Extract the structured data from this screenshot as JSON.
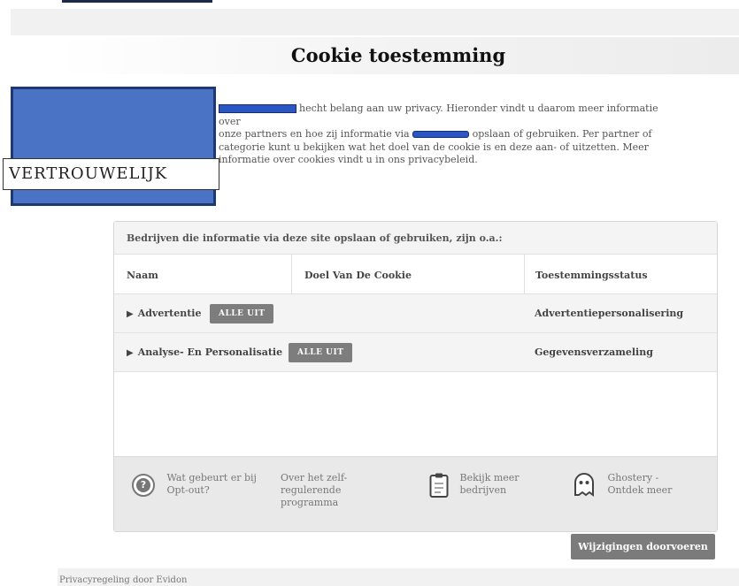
{
  "header": {
    "title": "Cookie toestemming"
  },
  "intro": {
    "part1": "hecht belang aan uw privacy. Hieronder vindt u daarom meer informatie over",
    "part2": "onze partners en hoe zij informatie via",
    "part3": "opslaan of gebruiken. Per partner of",
    "part4": "categorie kunt u bekijken wat het doel van de cookie is en deze aan- of uitzetten. Meer",
    "part5": "informatie over cookies vindt u in ons privacybeleid."
  },
  "overlay": {
    "label": "VERTROUWELIJK"
  },
  "panel": {
    "heading": "Bedrijven die informatie via deze site opslaan of gebruiken, zijn o.a.:",
    "columns": [
      "Naam",
      "Doel Van De Cookie",
      "Toestemmingsstatus"
    ],
    "rows": [
      {
        "arrow": "▶",
        "name": "Advertentie",
        "button": "ALLE UIT",
        "status": "Advertentiepersonalisering"
      },
      {
        "arrow": "▶",
        "name": "Analyse- En Personalisatie",
        "button": "ALLE UIT",
        "status": "Gegevensverzameling"
      }
    ]
  },
  "footer": {
    "optout_l1": "Wat gebeurt er bij",
    "optout_l2": "Opt-out?",
    "program_l1": "Over het zelf-",
    "program_l2": "regulerende",
    "program_l3": "programma",
    "more_l1": "Bekijk meer",
    "more_l2": "bedrijven",
    "ghostery_l1": "Ghostery -",
    "ghostery_l2": "Ontdek meer",
    "question_glyph": "?"
  },
  "apply_button": "Wijzigingen doorvoeren",
  "bottom": {
    "text": "Privacyregeling door Evidon"
  },
  "colors": {
    "redaction": "#2a56c6",
    "button": "#7b7b7b",
    "panel_bg": "#f4f4f4"
  },
  "icons": [
    "question-icon",
    "clipboard-icon",
    "ghost-icon"
  ]
}
